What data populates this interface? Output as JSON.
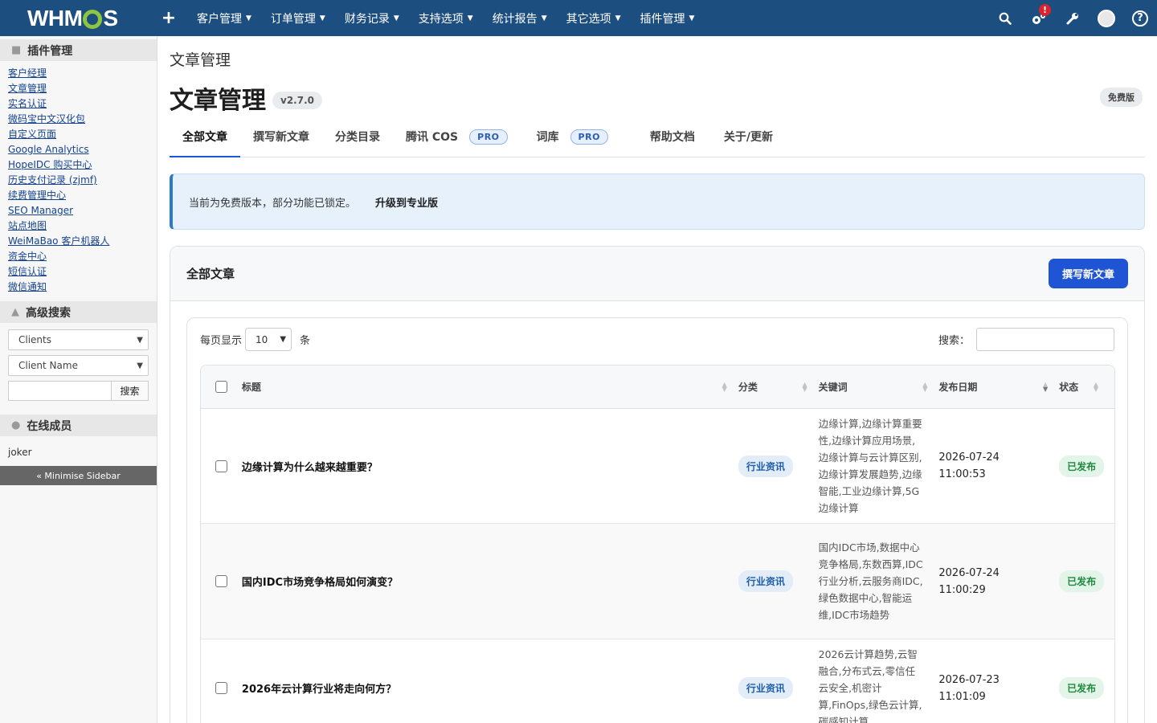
{
  "topbar": {
    "logo": "WHMCS",
    "menu": [
      "客户管理",
      "订单管理",
      "财务记录",
      "支持选项",
      "统计报告",
      "其它选项",
      "插件管理"
    ],
    "alert_count": "!",
    "help_label": "?"
  },
  "sidebar": {
    "addons_title": "插件管理",
    "addons": [
      "客户经理",
      "文章管理",
      "实名认证",
      "微码宝中文汉化包",
      "自定义页面",
      "Google Analytics",
      "HopeIDC 购买中心",
      "历史支付记录 (zjmf)",
      "续费管理中心",
      "SEO Manager",
      "站点地图",
      "WeiMaBao 客户机器人",
      "资金中心",
      "短信认证",
      "微信通知"
    ],
    "search_title": "高级搜索",
    "search_type": "Clients",
    "search_field": "Client Name",
    "search_button": "搜索",
    "online_title": "在线成员",
    "online_user": "joker",
    "minimise": "« Minimise Sidebar"
  },
  "page": {
    "breadcrumb": "文章管理",
    "title": "文章管理",
    "version": "v2.7.0",
    "edition": "免费版",
    "tabs": [
      {
        "label": "全部文章"
      },
      {
        "label": "撰写新文章"
      },
      {
        "label": "分类目录"
      },
      {
        "label": "腾讯 COS",
        "badge": "PRO"
      },
      {
        "label": "词库",
        "badge": "PRO"
      },
      {
        "label": "帮助文档"
      },
      {
        "label": "关于/更新"
      }
    ],
    "notice_text": "当前为免费版本，部分功能已锁定。",
    "notice_link": "升级到专业版"
  },
  "card": {
    "title": "全部文章",
    "new_button": "撰写新文章",
    "length_prefix": "每页显示",
    "length_value": "10",
    "length_suffix": "条",
    "search_label": "搜索："
  },
  "table": {
    "columns": [
      "标题",
      "分类",
      "关键词",
      "发布日期",
      "状态"
    ],
    "rows": [
      {
        "title": "边缘计算为什么越来越重要？",
        "category": "行业资讯",
        "keywords": "边缘计算,边缘计算重要性,边缘计算应用场景,边缘计算与云计算区别,边缘计算发展趋势,边缘智能,工业边缘计算,5G边缘计算",
        "date": "2026-07-24",
        "time": "11:00:53",
        "status": "已发布"
      },
      {
        "title": "国内IDC市场竞争格局如何演变？",
        "category": "行业资讯",
        "keywords": "国内IDC市场,数据中心竞争格局,东数西算,IDC行业分析,云服务商IDC,绿色数据中心,智能运维,IDC市场趋势",
        "date": "2026-07-24",
        "time": "11:00:29",
        "status": "已发布"
      },
      {
        "title": "2026年云计算行业将走向何方？",
        "category": "行业资讯",
        "keywords": "2026云计算趋势,云智融合,分布式云,零信任云安全,机密计算,FinOps,绿色云计算,碳感知计算",
        "date": "2026-07-23",
        "time": "11:01:09",
        "status": "已发布"
      }
    ]
  }
}
